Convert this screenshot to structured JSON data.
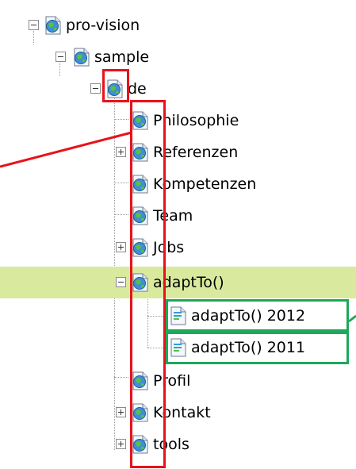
{
  "tree": {
    "nodes": [
      {
        "label": "pro-vision",
        "level": 0,
        "toggle": "minus",
        "icon": "globe-page-icon"
      },
      {
        "label": "sample",
        "level": 1,
        "toggle": "minus",
        "icon": "globe-page-icon"
      },
      {
        "label": "de",
        "level": 2,
        "toggle": "minus",
        "icon": "globe-page-icon"
      },
      {
        "label": "Philosophie",
        "level": 3,
        "toggle": "none",
        "icon": "globe-page-icon"
      },
      {
        "label": "Referenzen",
        "level": 3,
        "toggle": "plus",
        "icon": "globe-page-icon"
      },
      {
        "label": "Kompetenzen",
        "level": 3,
        "toggle": "none",
        "icon": "globe-page-icon"
      },
      {
        "label": "Team",
        "level": 3,
        "toggle": "none",
        "icon": "globe-page-icon"
      },
      {
        "label": "Jobs",
        "level": 3,
        "toggle": "plus",
        "icon": "globe-page-icon"
      },
      {
        "label": "adaptTo()",
        "level": 3,
        "toggle": "minus",
        "icon": "globe-page-icon",
        "selected": true
      },
      {
        "label": "adaptTo() 2012",
        "level": 4,
        "toggle": "none",
        "icon": "page-icon"
      },
      {
        "label": "adaptTo() 2011",
        "level": 4,
        "toggle": "none",
        "icon": "page-icon"
      },
      {
        "label": "Profil",
        "level": 3,
        "toggle": "none",
        "icon": "globe-page-icon"
      },
      {
        "label": "Kontakt",
        "level": 3,
        "toggle": "plus",
        "icon": "globe-page-icon"
      },
      {
        "label": "tools",
        "level": 3,
        "toggle": "plus",
        "icon": "globe-page-icon"
      }
    ]
  },
  "colors": {
    "selected_row": "#d9ea9e",
    "highlight_red": "#e8121a",
    "highlight_green": "#1ea85a"
  }
}
